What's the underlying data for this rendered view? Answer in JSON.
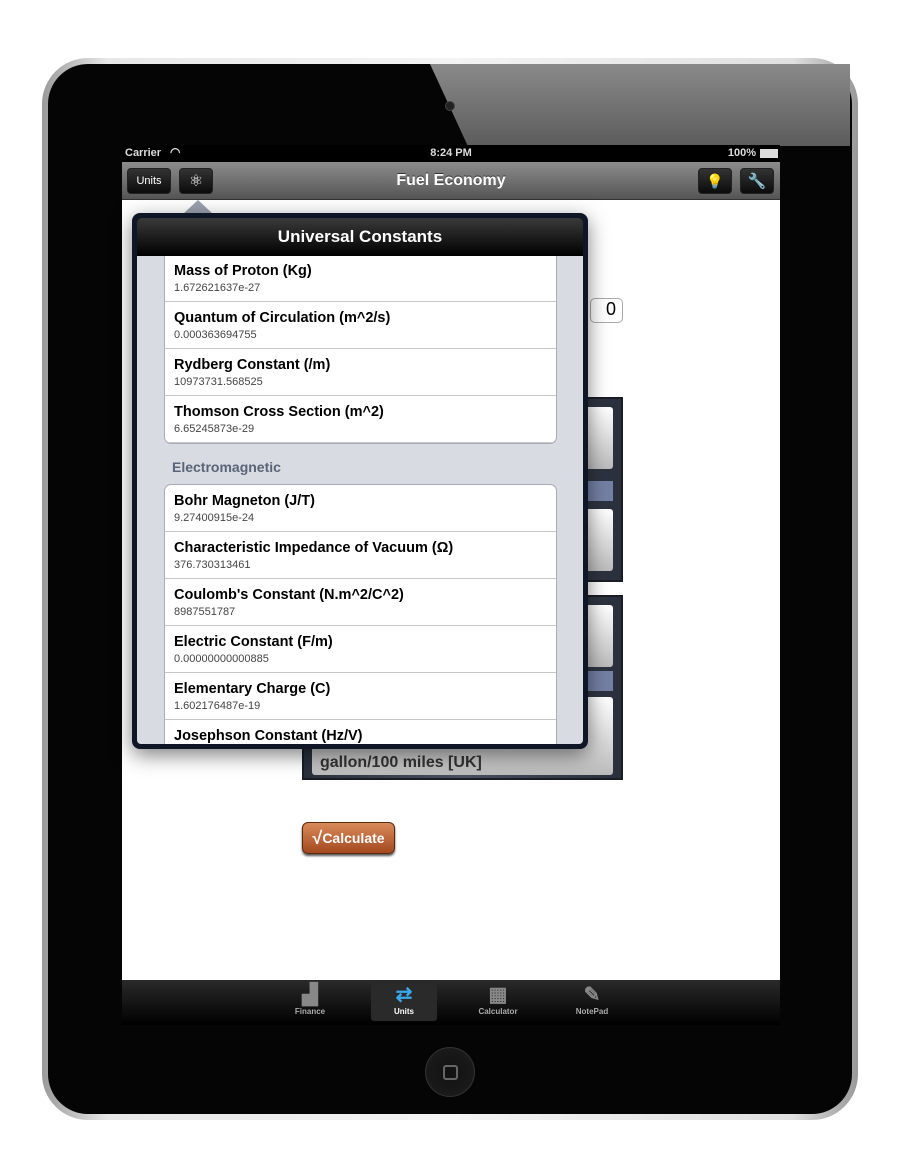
{
  "status": {
    "carrier": "Carrier",
    "time": "8:24 PM",
    "battery": "100%"
  },
  "nav": {
    "units_button": "Units",
    "title": "Fuel Economy",
    "left_icon": "atom-icon",
    "right_icons": [
      "lightbulb-icon",
      "wrench-icon"
    ]
  },
  "background": {
    "input_value": "0",
    "picker_value": "gallon/100 miles [UK]",
    "calculate_button": "Calculate"
  },
  "popover": {
    "title": "Universal Constants",
    "group1": [
      {
        "name": "Mass of Proton (Kg)",
        "value": "1.672621637e-27"
      },
      {
        "name": "Quantum of Circulation (m^2/s)",
        "value": "0.000363694755"
      },
      {
        "name": "Rydberg Constant (/m)",
        "value": "10973731.568525"
      },
      {
        "name": "Thomson Cross Section (m^2)",
        "value": "6.65245873e-29"
      }
    ],
    "section": "Electromagnetic",
    "group2": [
      {
        "name": "Bohr Magneton (J/T)",
        "value": "9.27400915e-24"
      },
      {
        "name": "Characteristic Impedance of Vacuum (Ω)",
        "value": "376.730313461"
      },
      {
        "name": "Coulomb's Constant (N.m^2/C^2)",
        "value": "8987551787"
      },
      {
        "name": "Electric Constant (F/m)",
        "value": "0.00000000000885"
      },
      {
        "name": "Elementary Charge (C)",
        "value": "1.602176487e-19"
      },
      {
        "name": "Josephson Constant (Hz/V)",
        "value": ""
      }
    ]
  },
  "tabs": [
    {
      "label": "Finance",
      "icon": "finance-chart-icon"
    },
    {
      "label": "Units",
      "icon": "swap-arrows-icon",
      "selected": true
    },
    {
      "label": "Calculator",
      "icon": "calculator-icon"
    },
    {
      "label": "NotePad",
      "icon": "notepad-icon"
    }
  ],
  "colors": {
    "accent_blue": "#3aa8f0",
    "calculate": "#b8582a"
  }
}
